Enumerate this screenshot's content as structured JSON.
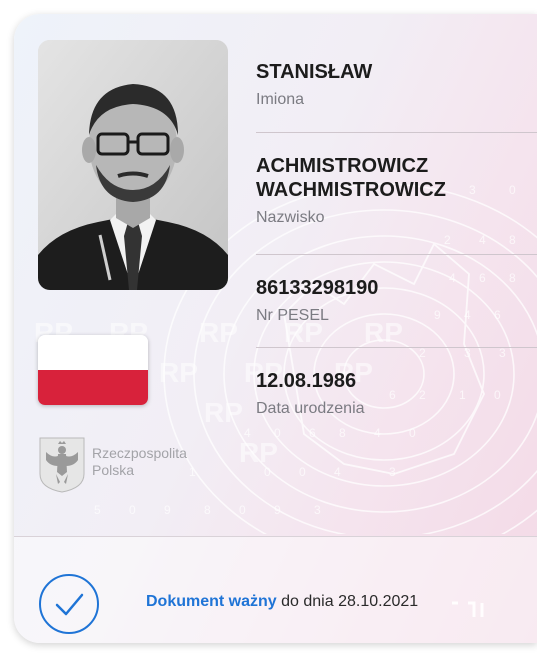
{
  "person": {
    "first_name": "STANISŁAW",
    "first_name_label": "Imiona",
    "surname": "ACHMISTROWICZ WACHMISTROWICZ",
    "surname_label": "Nazwisko",
    "pesel": "86133298190",
    "pesel_label": "Nr PESEL",
    "birth_date": "12.08.1986",
    "birth_date_label": "Data urodzenia"
  },
  "country": {
    "line1": "Rzeczpospolita",
    "line2": "Polska"
  },
  "status": {
    "valid_label": "Dokument ważny",
    "until_label": "do dnia 28.10.2021"
  },
  "colors": {
    "accent": "#1f74d6",
    "flag_red": "#d8223b",
    "flag_white": "#ffffff"
  },
  "icons": {
    "status": "check-circle-icon",
    "emblem": "polish-eagle-emblem",
    "photo": "holder-photo"
  }
}
